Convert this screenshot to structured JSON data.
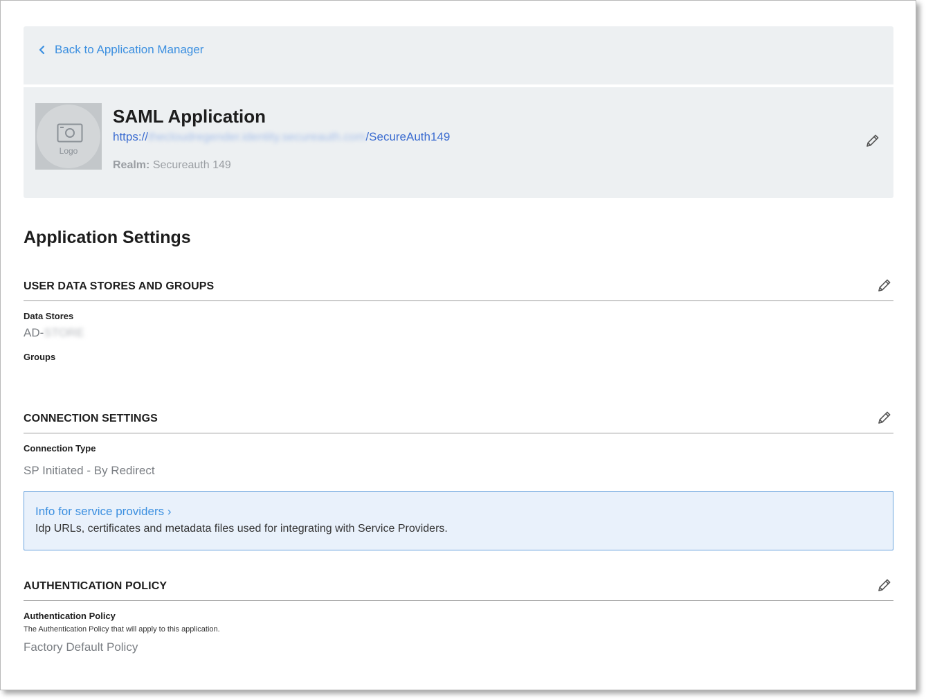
{
  "nav": {
    "back_label": "Back to Application Manager"
  },
  "app": {
    "logo_label": "Logo",
    "title": "SAML Application",
    "url_prefix": "https://",
    "url_host_obscured": "thecloudregender.identity.secureauth.com",
    "url_path": "/SecureAuth149",
    "realm_label": "Realm:",
    "realm_value": "Secureauth 149"
  },
  "page": {
    "heading": "Application Settings"
  },
  "sections": {
    "user_data": {
      "title": "USER DATA STORES AND GROUPS",
      "data_stores_label": "Data Stores",
      "data_stores_value_prefix": "AD-",
      "data_stores_value_obscured": "STORE",
      "groups_label": "Groups"
    },
    "connection": {
      "title": "CONNECTION SETTINGS",
      "type_label": "Connection Type",
      "type_value": "SP Initiated - By Redirect",
      "info_link": "Info for service providers ›",
      "info_desc": "Idp URLs, certificates and metadata files used for integrating with Service Providers."
    },
    "auth_policy": {
      "title": "AUTHENTICATION POLICY",
      "policy_label": "Authentication Policy",
      "policy_help": "The Authentication Policy that will apply to this application.",
      "policy_value": "Factory Default Policy"
    }
  },
  "icons": {
    "edit": "pencil-icon",
    "back": "chevron-left-icon",
    "logo": "camera-icon"
  },
  "colors": {
    "link": "#3b8fe0",
    "panel_bg": "#edf0f2",
    "info_bg": "#e9f1fb",
    "info_border": "#6aa3dd"
  }
}
